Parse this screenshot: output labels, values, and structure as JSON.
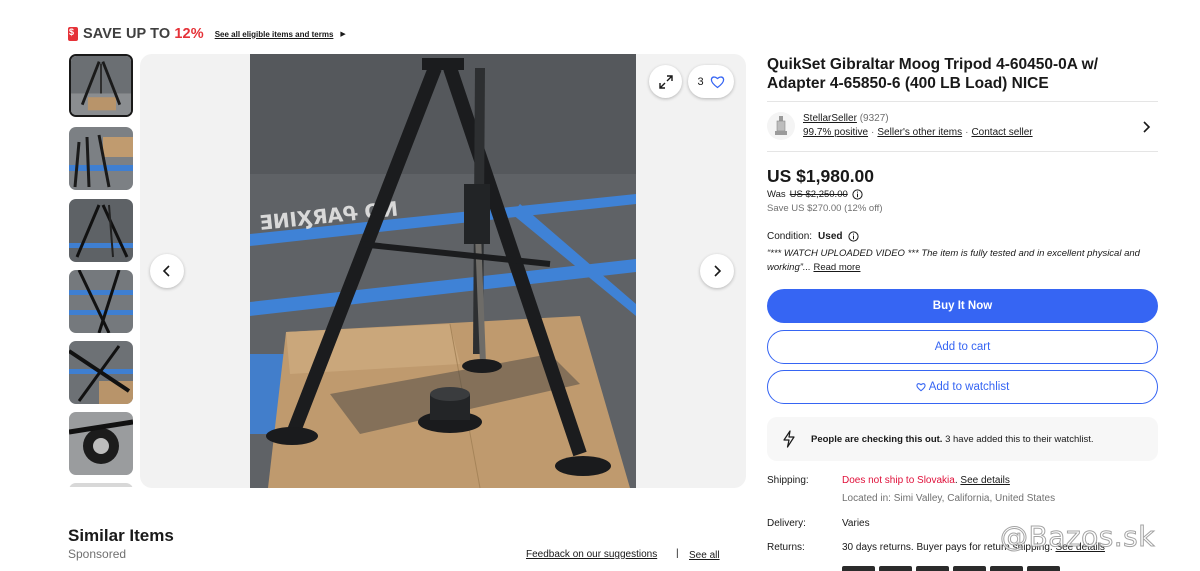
{
  "promo": {
    "headline_prefix": "SAVE UP TO ",
    "headline_pct": "12%",
    "terms_link": "See all eligible items and terms"
  },
  "gallery": {
    "thumbnail_count": 7,
    "active_index": 0,
    "watch_count": "3"
  },
  "item": {
    "title": "QuikSet Gibraltar Moog Tripod 4-60450-0A w/ Adapter 4-65850-6 (400 LB Load) NICE"
  },
  "seller": {
    "name": "StellarSeller",
    "feedback_count": "(9327)",
    "positive": "99.7% positive",
    "other_items": "Seller's other items",
    "contact": "Contact seller"
  },
  "pricing": {
    "price": "US $1,980.00",
    "was_label": "Was",
    "was_price": "US $2,250.00",
    "save": "Save US $270.00 (12% off)"
  },
  "condition": {
    "label": "Condition:",
    "value": "Used",
    "description": "“*** WATCH UPLOADED VIDEO *** The item is fully tested and in excellent physical and working”",
    "ellipsis": "...",
    "read_more": "Read more"
  },
  "actions": {
    "buy_now": "Buy It Now",
    "add_to_cart": "Add to cart",
    "add_to_watchlist": "Add to watchlist"
  },
  "notice": {
    "bold": "People are checking this out.",
    "text": " 3 have added this to their watchlist."
  },
  "shipping": {
    "label": "Shipping:",
    "value": "Does not ship to Slovakia",
    "period": ".",
    "details_link": "See details",
    "location": "Located in: Simi Valley, California, United States"
  },
  "delivery": {
    "label": "Delivery:",
    "value": "Varies"
  },
  "returns": {
    "label": "Returns:",
    "value": "30 days returns. Buyer pays for return shipping. ",
    "details_link": "See details"
  },
  "similar": {
    "title": "Similar Items",
    "sponsored": "Sponsored",
    "feedback_link": "Feedback on our suggestions",
    "separator": "|",
    "see_all": "See all"
  },
  "watermark": "@Bazos.sk",
  "colors": {
    "accent_blue": "#3665f3",
    "promo_red": "#e53238",
    "warning_red": "#e0103a"
  }
}
